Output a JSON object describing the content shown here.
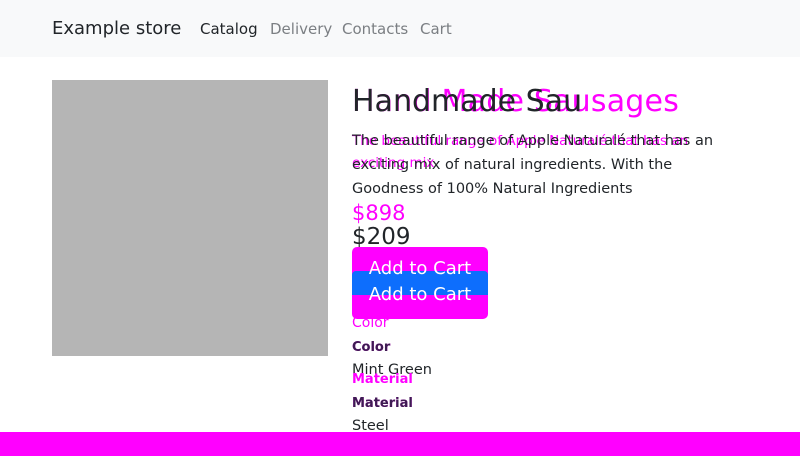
{
  "navbar": {
    "brand": "Example store",
    "links": [
      {
        "label": "Catalog",
        "active": true
      },
      {
        "label": "Delivery",
        "active": false
      },
      {
        "label": "Contacts",
        "active": false
      },
      {
        "label": "Cart",
        "active": false
      }
    ]
  },
  "product": {
    "title": "Hand Made Sausages",
    "title_overlay": "Handmade Sau",
    "description": "The beautiful range of Apple Naturalé that has an exciting mix of natural ingredients. With the Goodness of 100% Natural Ingredients",
    "description_overlay": "The beautiful range of Apple Naturalé that has an exciting mix",
    "old_price": "$898",
    "price": "$209",
    "add_to_cart_label": "Add to Cart",
    "specs": {
      "color_label": "Color",
      "color_value": "Mint Green",
      "material_label": "Material",
      "material_value": "Steel"
    }
  },
  "colors": {
    "overlay": "#ff00ff",
    "primary": "#0d6efd",
    "navbar_bg": "#f8f9fa",
    "image_placeholder": "#b5b5b5"
  }
}
